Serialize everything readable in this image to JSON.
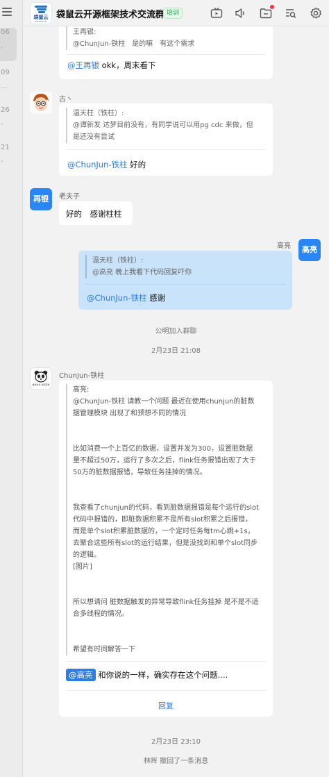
{
  "sidebar": {
    "items": [
      {
        "time": "06",
        "dot": ","
      },
      {
        "time": "09",
        "dot": "..."
      },
      {
        "time": "26",
        "dot": "-"
      },
      {
        "time": "21",
        "dot": "-"
      }
    ]
  },
  "header": {
    "logo_text": "袋鼠云",
    "logo_sub": "DTSTACK",
    "title": "袋鼠云开源框架技术交流群",
    "tag": "培训"
  },
  "messages": {
    "m1": {
      "quote_name": "王再银:",
      "quote_text": "@ChunJun-铁柱　是的嘛　有这个需求",
      "mention": "@王再银",
      "text": " okk，周末看下"
    },
    "m2": {
      "sender": "古丶",
      "quote_name": "温天柱（铁柱）:",
      "quote_lines": [
        "@谭新发  达梦目前没有，有同学说可以用pg cdc 来做，但",
        "是还没有尝试"
      ],
      "mention": "@ChunJun-铁柱",
      "text": " 好的"
    },
    "m3": {
      "sender": "老夫子",
      "avatar_text": "再银",
      "text": "好的　感谢柱柱"
    },
    "m4": {
      "sender": "高亮",
      "avatar_text": "高亮",
      "quote_name": "温天柱（铁柱）:",
      "quote_text": "@高亮  晚上我看下代码回复吓你",
      "mention": "@ChunJun-铁柱",
      "text": " 感谢"
    },
    "sys1": "公明加入群聊",
    "time1": "2月23日 21:08",
    "m5": {
      "sender": "ChunJun-铁柱",
      "avatar_caption": "袋鼠学长 社区研发",
      "quote_lines": [
        "高亮:",
        "@ChunJun-铁柱 请教一个问题 最近在使用chunjun的脏数",
        "据管理模块 出现了和预想不同的情况",
        "",
        "",
        "比如消费一个上百亿的数据，设置并发为300，设置脏数据",
        "量不超过50万，运行了多次之后，flink任务报错出现了大于",
        "50万的脏数据报错，导致任务挂掉的情况。",
        "",
        "",
        "我查看了chunjun的代码，看到脏数据报错是每个运行的slot",
        "代码中报错的，即脏数据积累不是所有slot积累之后报错，",
        "而是单个slot积累脏数据的，一个定时任务每tm心跳+1s，",
        "去聚合这些所有slot的运行结果，但是没找到和单个slot同步",
        "的逻辑。",
        "[图片]",
        "",
        "",
        "所以想请问 脏数据触发的异常导致flink任务挂掉 是不是不适",
        "合多线程的情况。",
        "",
        "",
        "希望有时间解答一下"
      ],
      "mention": "@高亮",
      "text": " 和你说的一样，确实存在这个问题....",
      "reply_label": "回复"
    },
    "time2": "2月23日 23:10",
    "sys2": "林晖 撤回了一条消息"
  },
  "colors": {
    "accent": "#2a7ae8",
    "my_bubble": "#c9e3fb",
    "tag_green": "#16a34a",
    "badge_red": "#f5333f"
  },
  "icons": [
    "menu-icon",
    "tv-icon",
    "speaker-icon",
    "folder-icon",
    "search-list-icon",
    "settings-icon"
  ]
}
